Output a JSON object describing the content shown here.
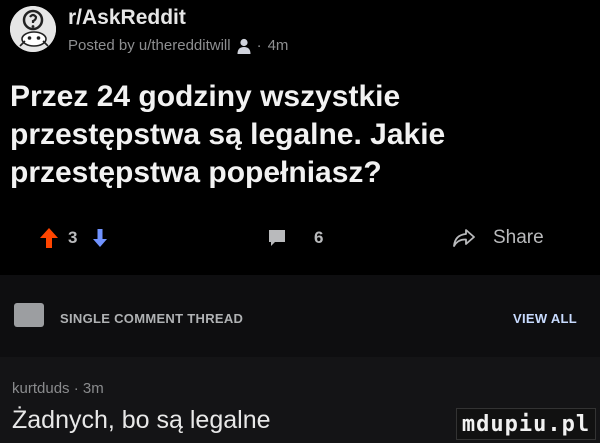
{
  "post": {
    "subreddit": "r/AskReddit",
    "posted_by": "Posted by u/theredditwill",
    "separator": "·",
    "age": "4m",
    "avatar_icon": "askreddit-alien-avatar",
    "mod_icon": "person-icon",
    "title_lines": [
      "Przez 24 godziny wszystkie",
      "przestępstwa są legalne. Jakie",
      "przestępstwa popełniasz?"
    ]
  },
  "actions": {
    "upvote_icon": "arrow-up-icon",
    "vote_count": "3",
    "downvote_icon": "arrow-down-icon",
    "comments_icon": "comment-bubble-icon",
    "comment_count": "6",
    "share_icon": "share-arrow-icon",
    "share_label": "Share"
  },
  "thread": {
    "label": "SINGLE COMMENT THREAD",
    "view_all": "VIEW ALL"
  },
  "comment": {
    "meta": "kurtduds · 3m",
    "text": "Żadnych, bo są legalne"
  },
  "watermark": "mdupiu.pl",
  "colors": {
    "background": "#000000",
    "upvote": "#ff4500",
    "downvote": "#7193ff",
    "view_all": "#c8dbff"
  }
}
